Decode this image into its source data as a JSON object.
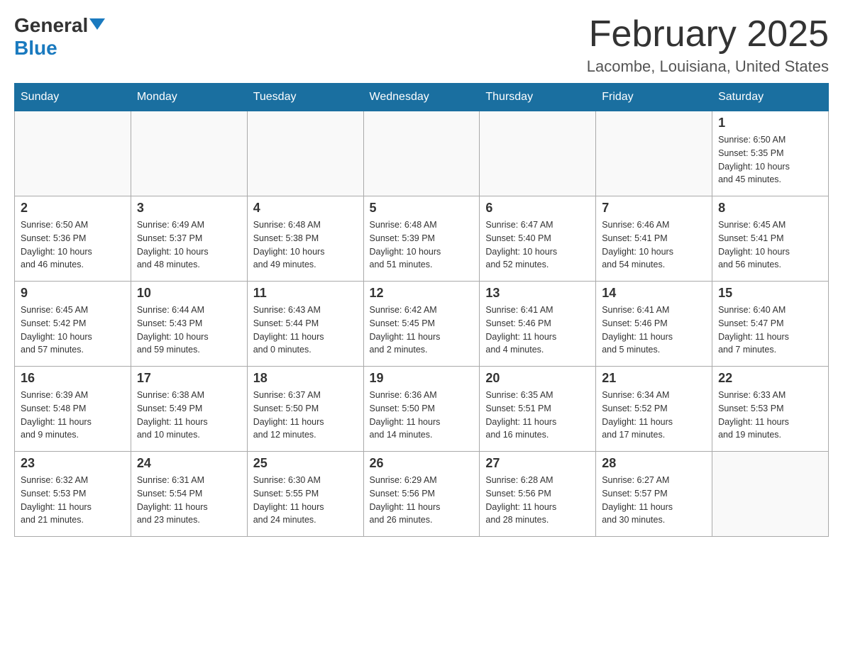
{
  "logo": {
    "general": "General",
    "blue": "Blue"
  },
  "title": {
    "month": "February 2025",
    "location": "Lacombe, Louisiana, United States"
  },
  "weekdays": [
    "Sunday",
    "Monday",
    "Tuesday",
    "Wednesday",
    "Thursday",
    "Friday",
    "Saturday"
  ],
  "weeks": [
    [
      {
        "day": "",
        "info": []
      },
      {
        "day": "",
        "info": []
      },
      {
        "day": "",
        "info": []
      },
      {
        "day": "",
        "info": []
      },
      {
        "day": "",
        "info": []
      },
      {
        "day": "",
        "info": []
      },
      {
        "day": "1",
        "info": [
          "Sunrise: 6:50 AM",
          "Sunset: 5:35 PM",
          "Daylight: 10 hours",
          "and 45 minutes."
        ]
      }
    ],
    [
      {
        "day": "2",
        "info": [
          "Sunrise: 6:50 AM",
          "Sunset: 5:36 PM",
          "Daylight: 10 hours",
          "and 46 minutes."
        ]
      },
      {
        "day": "3",
        "info": [
          "Sunrise: 6:49 AM",
          "Sunset: 5:37 PM",
          "Daylight: 10 hours",
          "and 48 minutes."
        ]
      },
      {
        "day": "4",
        "info": [
          "Sunrise: 6:48 AM",
          "Sunset: 5:38 PM",
          "Daylight: 10 hours",
          "and 49 minutes."
        ]
      },
      {
        "day": "5",
        "info": [
          "Sunrise: 6:48 AM",
          "Sunset: 5:39 PM",
          "Daylight: 10 hours",
          "and 51 minutes."
        ]
      },
      {
        "day": "6",
        "info": [
          "Sunrise: 6:47 AM",
          "Sunset: 5:40 PM",
          "Daylight: 10 hours",
          "and 52 minutes."
        ]
      },
      {
        "day": "7",
        "info": [
          "Sunrise: 6:46 AM",
          "Sunset: 5:41 PM",
          "Daylight: 10 hours",
          "and 54 minutes."
        ]
      },
      {
        "day": "8",
        "info": [
          "Sunrise: 6:45 AM",
          "Sunset: 5:41 PM",
          "Daylight: 10 hours",
          "and 56 minutes."
        ]
      }
    ],
    [
      {
        "day": "9",
        "info": [
          "Sunrise: 6:45 AM",
          "Sunset: 5:42 PM",
          "Daylight: 10 hours",
          "and 57 minutes."
        ]
      },
      {
        "day": "10",
        "info": [
          "Sunrise: 6:44 AM",
          "Sunset: 5:43 PM",
          "Daylight: 10 hours",
          "and 59 minutes."
        ]
      },
      {
        "day": "11",
        "info": [
          "Sunrise: 6:43 AM",
          "Sunset: 5:44 PM",
          "Daylight: 11 hours",
          "and 0 minutes."
        ]
      },
      {
        "day": "12",
        "info": [
          "Sunrise: 6:42 AM",
          "Sunset: 5:45 PM",
          "Daylight: 11 hours",
          "and 2 minutes."
        ]
      },
      {
        "day": "13",
        "info": [
          "Sunrise: 6:41 AM",
          "Sunset: 5:46 PM",
          "Daylight: 11 hours",
          "and 4 minutes."
        ]
      },
      {
        "day": "14",
        "info": [
          "Sunrise: 6:41 AM",
          "Sunset: 5:46 PM",
          "Daylight: 11 hours",
          "and 5 minutes."
        ]
      },
      {
        "day": "15",
        "info": [
          "Sunrise: 6:40 AM",
          "Sunset: 5:47 PM",
          "Daylight: 11 hours",
          "and 7 minutes."
        ]
      }
    ],
    [
      {
        "day": "16",
        "info": [
          "Sunrise: 6:39 AM",
          "Sunset: 5:48 PM",
          "Daylight: 11 hours",
          "and 9 minutes."
        ]
      },
      {
        "day": "17",
        "info": [
          "Sunrise: 6:38 AM",
          "Sunset: 5:49 PM",
          "Daylight: 11 hours",
          "and 10 minutes."
        ]
      },
      {
        "day": "18",
        "info": [
          "Sunrise: 6:37 AM",
          "Sunset: 5:50 PM",
          "Daylight: 11 hours",
          "and 12 minutes."
        ]
      },
      {
        "day": "19",
        "info": [
          "Sunrise: 6:36 AM",
          "Sunset: 5:50 PM",
          "Daylight: 11 hours",
          "and 14 minutes."
        ]
      },
      {
        "day": "20",
        "info": [
          "Sunrise: 6:35 AM",
          "Sunset: 5:51 PM",
          "Daylight: 11 hours",
          "and 16 minutes."
        ]
      },
      {
        "day": "21",
        "info": [
          "Sunrise: 6:34 AM",
          "Sunset: 5:52 PM",
          "Daylight: 11 hours",
          "and 17 minutes."
        ]
      },
      {
        "day": "22",
        "info": [
          "Sunrise: 6:33 AM",
          "Sunset: 5:53 PM",
          "Daylight: 11 hours",
          "and 19 minutes."
        ]
      }
    ],
    [
      {
        "day": "23",
        "info": [
          "Sunrise: 6:32 AM",
          "Sunset: 5:53 PM",
          "Daylight: 11 hours",
          "and 21 minutes."
        ]
      },
      {
        "day": "24",
        "info": [
          "Sunrise: 6:31 AM",
          "Sunset: 5:54 PM",
          "Daylight: 11 hours",
          "and 23 minutes."
        ]
      },
      {
        "day": "25",
        "info": [
          "Sunrise: 6:30 AM",
          "Sunset: 5:55 PM",
          "Daylight: 11 hours",
          "and 24 minutes."
        ]
      },
      {
        "day": "26",
        "info": [
          "Sunrise: 6:29 AM",
          "Sunset: 5:56 PM",
          "Daylight: 11 hours",
          "and 26 minutes."
        ]
      },
      {
        "day": "27",
        "info": [
          "Sunrise: 6:28 AM",
          "Sunset: 5:56 PM",
          "Daylight: 11 hours",
          "and 28 minutes."
        ]
      },
      {
        "day": "28",
        "info": [
          "Sunrise: 6:27 AM",
          "Sunset: 5:57 PM",
          "Daylight: 11 hours",
          "and 30 minutes."
        ]
      },
      {
        "day": "",
        "info": []
      }
    ]
  ]
}
